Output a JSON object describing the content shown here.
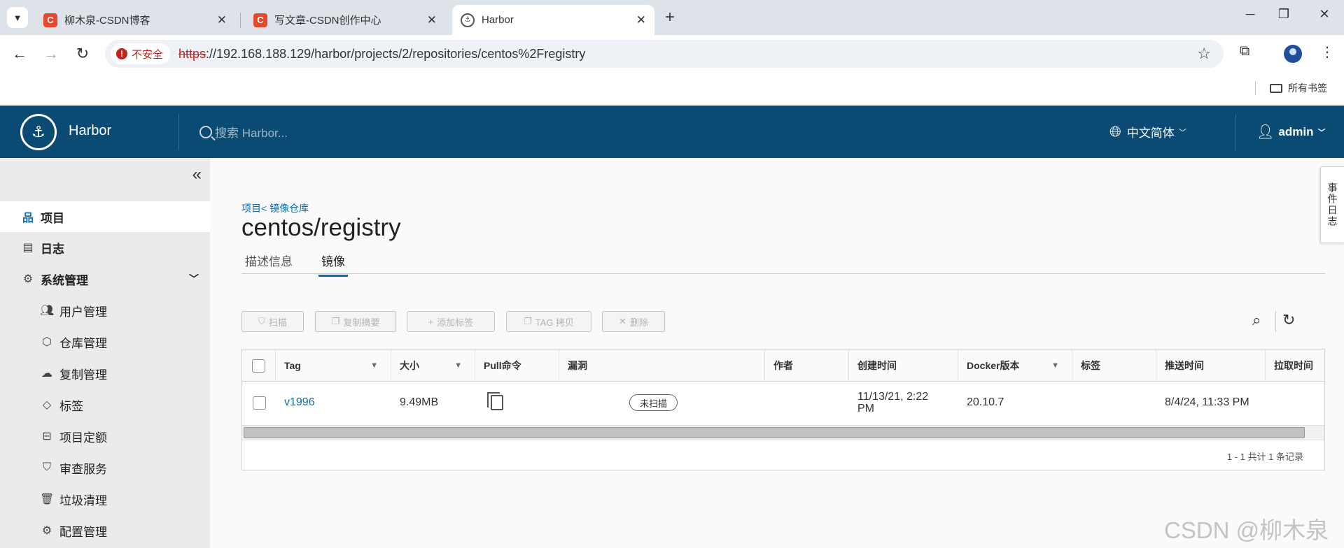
{
  "browser": {
    "tabs": [
      {
        "favicon": "C",
        "title": "柳木泉-CSDN博客",
        "close": "✕",
        "active": false
      },
      {
        "favicon": "C",
        "title": "写文章-CSDN创作中心",
        "close": "✕",
        "active": false
      },
      {
        "favicon": "harbor-logo-icon",
        "title": "Harbor",
        "close": "✕",
        "active": true
      }
    ],
    "new_tab": "+",
    "window_controls": {
      "minimize": "─",
      "restore": "❐",
      "close": "✕"
    },
    "security_label": "不安全",
    "url_scheme": "https",
    "url_rest": "://192.168.188.129/harbor/projects/2/repositories/centos%2Fregistry",
    "bookmarks_folder": "所有书签"
  },
  "harbor": {
    "app_name": "Harbor",
    "search_placeholder": "搜索 Harbor...",
    "language": "中文简体",
    "user": "admin"
  },
  "sidebar": {
    "items": [
      {
        "label": "项目",
        "icon": "projects-icon",
        "active": true
      },
      {
        "label": "日志",
        "icon": "logs-icon"
      },
      {
        "label": "系统管理",
        "icon": "admin-icon",
        "expandable": true
      },
      {
        "label": "用户管理",
        "icon": "users-icon"
      },
      {
        "label": "仓库管理",
        "icon": "registry-icon"
      },
      {
        "label": "复制管理",
        "icon": "replication-icon"
      },
      {
        "label": "标签",
        "icon": "tag-icon"
      },
      {
        "label": "项目定额",
        "icon": "quota-icon"
      },
      {
        "label": "审查服务",
        "icon": "shield-icon"
      },
      {
        "label": "垃圾清理",
        "icon": "trash-icon"
      },
      {
        "label": "配置管理",
        "icon": "gear-icon"
      }
    ]
  },
  "main": {
    "breadcrumb": "项目< 镜像仓库",
    "title": "centos/registry",
    "tabs": [
      {
        "label": "描述信息",
        "active": false
      },
      {
        "label": "镜像",
        "active": true
      }
    ],
    "actions": [
      {
        "label": "扫描",
        "icon": "shield-icon"
      },
      {
        "label": "复制摘要",
        "icon": "copy-icon"
      },
      {
        "label": "添加标签",
        "icon": "plus-icon"
      },
      {
        "label": "TAG 拷贝",
        "icon": "copy-icon"
      },
      {
        "label": "删除",
        "icon": "close-icon"
      }
    ],
    "table": {
      "columns": [
        "Tag",
        "大小",
        "Pull命令",
        "漏洞",
        "作者",
        "创建时间",
        "Docker版本",
        "标签",
        "推送时间",
        "拉取时间"
      ],
      "rows": [
        {
          "tag": "v1996",
          "size": "9.49MB",
          "pull_command": "copy-icon",
          "vulnerabilities": "未扫描",
          "author": "",
          "created": "11/13/21, 2:22 PM",
          "docker_version": "20.10.7",
          "labels": "",
          "pushed": "8/4/24, 11:33 PM",
          "pulled": ""
        }
      ],
      "footer": "1 - 1 共计 1 条记录"
    },
    "event_log": "事件日志"
  },
  "watermark": "CSDN @柳木泉",
  "colors": {
    "header_bg": "#0a4a73",
    "accent": "#0a6db1",
    "sidebar_bg": "#eaebec",
    "insecure": "#c5221f"
  }
}
